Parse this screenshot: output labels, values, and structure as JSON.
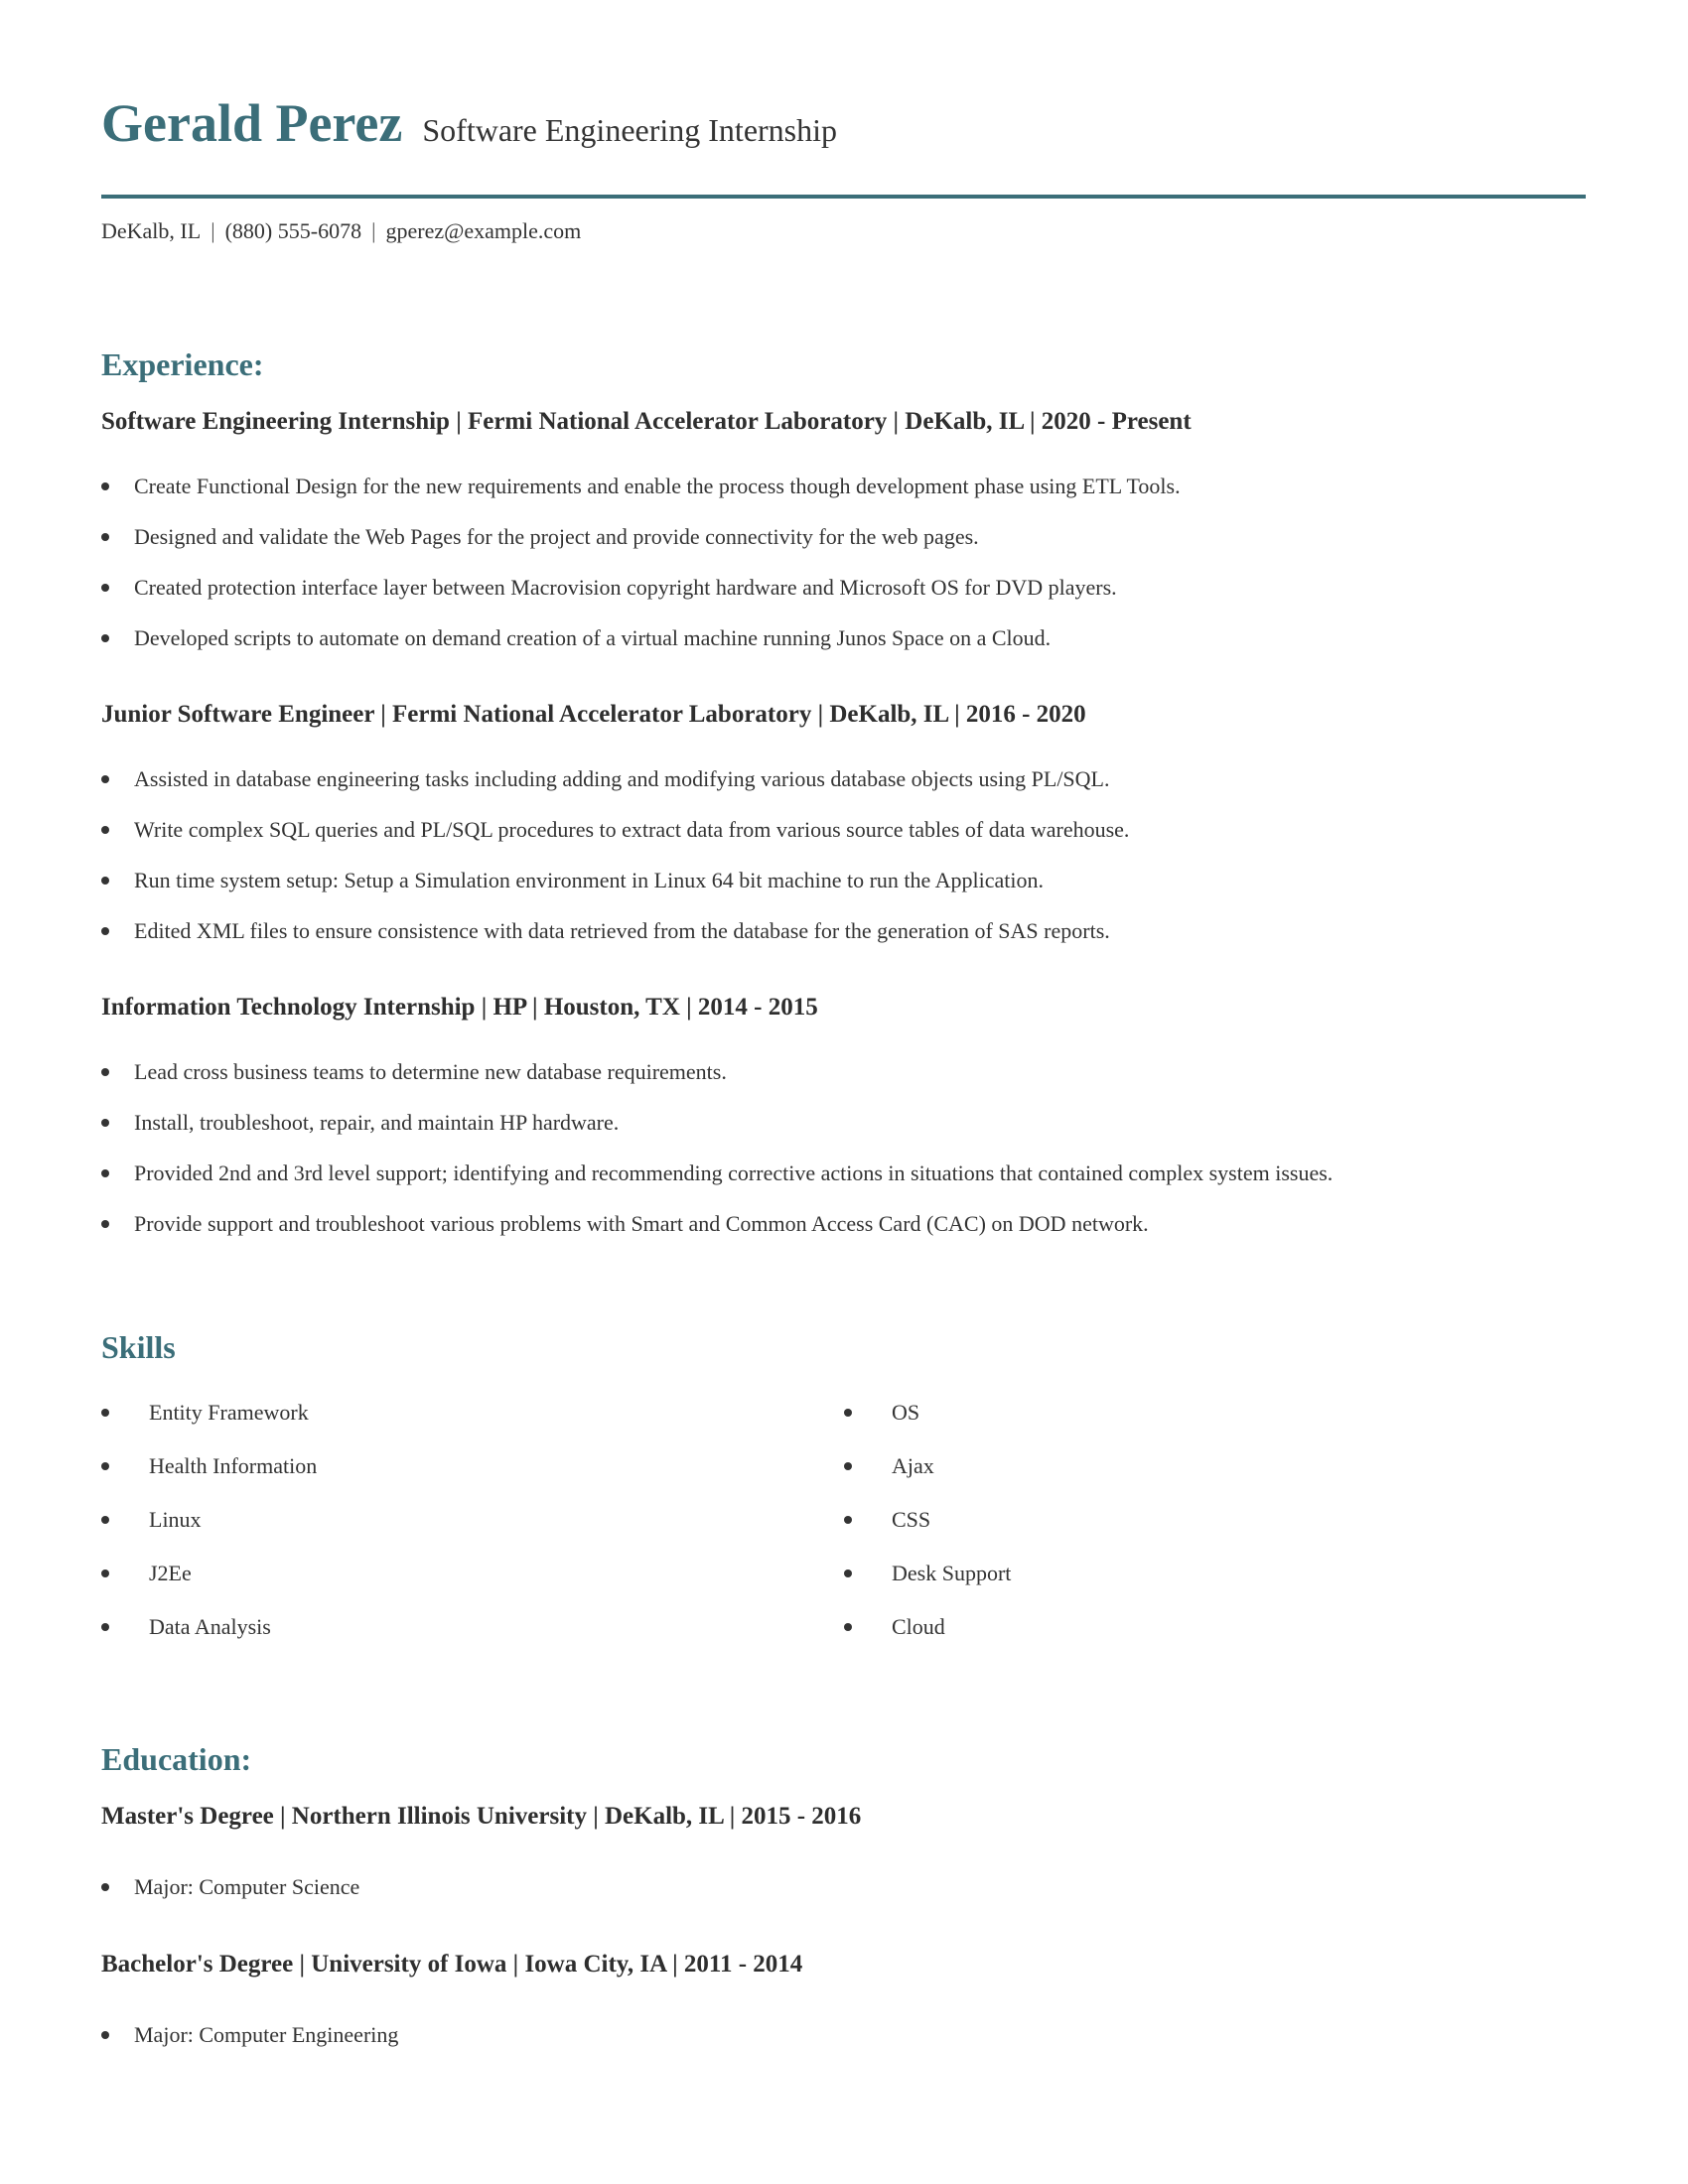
{
  "header": {
    "name": "Gerald Perez",
    "title": "Software Engineering Internship",
    "contact": {
      "location": "DeKalb, IL",
      "phone": "(880) 555-6078",
      "email": "gperez@example.com",
      "separator": "|"
    }
  },
  "colors": {
    "accent": "#3b6e79",
    "text": "#333333"
  },
  "experience": {
    "heading": "Experience:",
    "jobs": [
      {
        "title": "Software Engineering Internship | Fermi National Accelerator Laboratory | DeKalb, IL |  2020 - Present",
        "bullets": [
          "Create Functional Design for the new requirements and enable the process though development phase using ETL Tools.",
          "Designed and validate the Web Pages for the project and provide connectivity for the web pages.",
          "Created protection interface layer between Macrovision copyright hardware and Microsoft OS for DVD players.",
          "Developed scripts to automate on demand creation of a virtual machine running Junos Space on a Cloud."
        ]
      },
      {
        "title": "Junior Software Engineer | Fermi National Accelerator Laboratory | DeKalb, IL |  2016 - 2020",
        "bullets": [
          "Assisted in database engineering tasks including adding and modifying various database objects using PL/SQL.",
          "Write complex SQL queries and PL/SQL procedures to extract data from various source tables of data warehouse.",
          "Run time system setup: Setup a Simulation environment in Linux 64 bit machine to run the Application.",
          "Edited XML files to ensure consistence with data retrieved from the database for the generation of SAS reports."
        ]
      },
      {
        "title": "Information Technology Internship | HP | Houston, TX |  2014 - 2015",
        "bullets": [
          "Lead cross business teams to determine new database requirements.",
          "Install, troubleshoot, repair, and maintain HP hardware.",
          "Provided 2nd and 3rd level support; identifying and recommending corrective actions in situations that contained complex system issues.",
          "Provide support and troubleshoot various problems with Smart and Common Access Card (CAC) on DOD network."
        ]
      }
    ]
  },
  "skills": {
    "heading": "Skills",
    "left": [
      "Entity Framework",
      "Health Information",
      "Linux",
      "J2Ee",
      "Data Analysis"
    ],
    "right": [
      "OS",
      "Ajax",
      "CSS",
      "Desk Support",
      "Cloud"
    ]
  },
  "education": {
    "heading": "Education:",
    "entries": [
      {
        "title": "Master's Degree | Northern Illinois University | DeKalb, IL |  2015 - 2016",
        "bullets": [
          "Major: Computer Science"
        ]
      },
      {
        "title": "Bachelor's Degree | University of Iowa | Iowa City, IA |  2011 - 2014",
        "bullets": [
          "Major: Computer Engineering"
        ]
      }
    ]
  }
}
